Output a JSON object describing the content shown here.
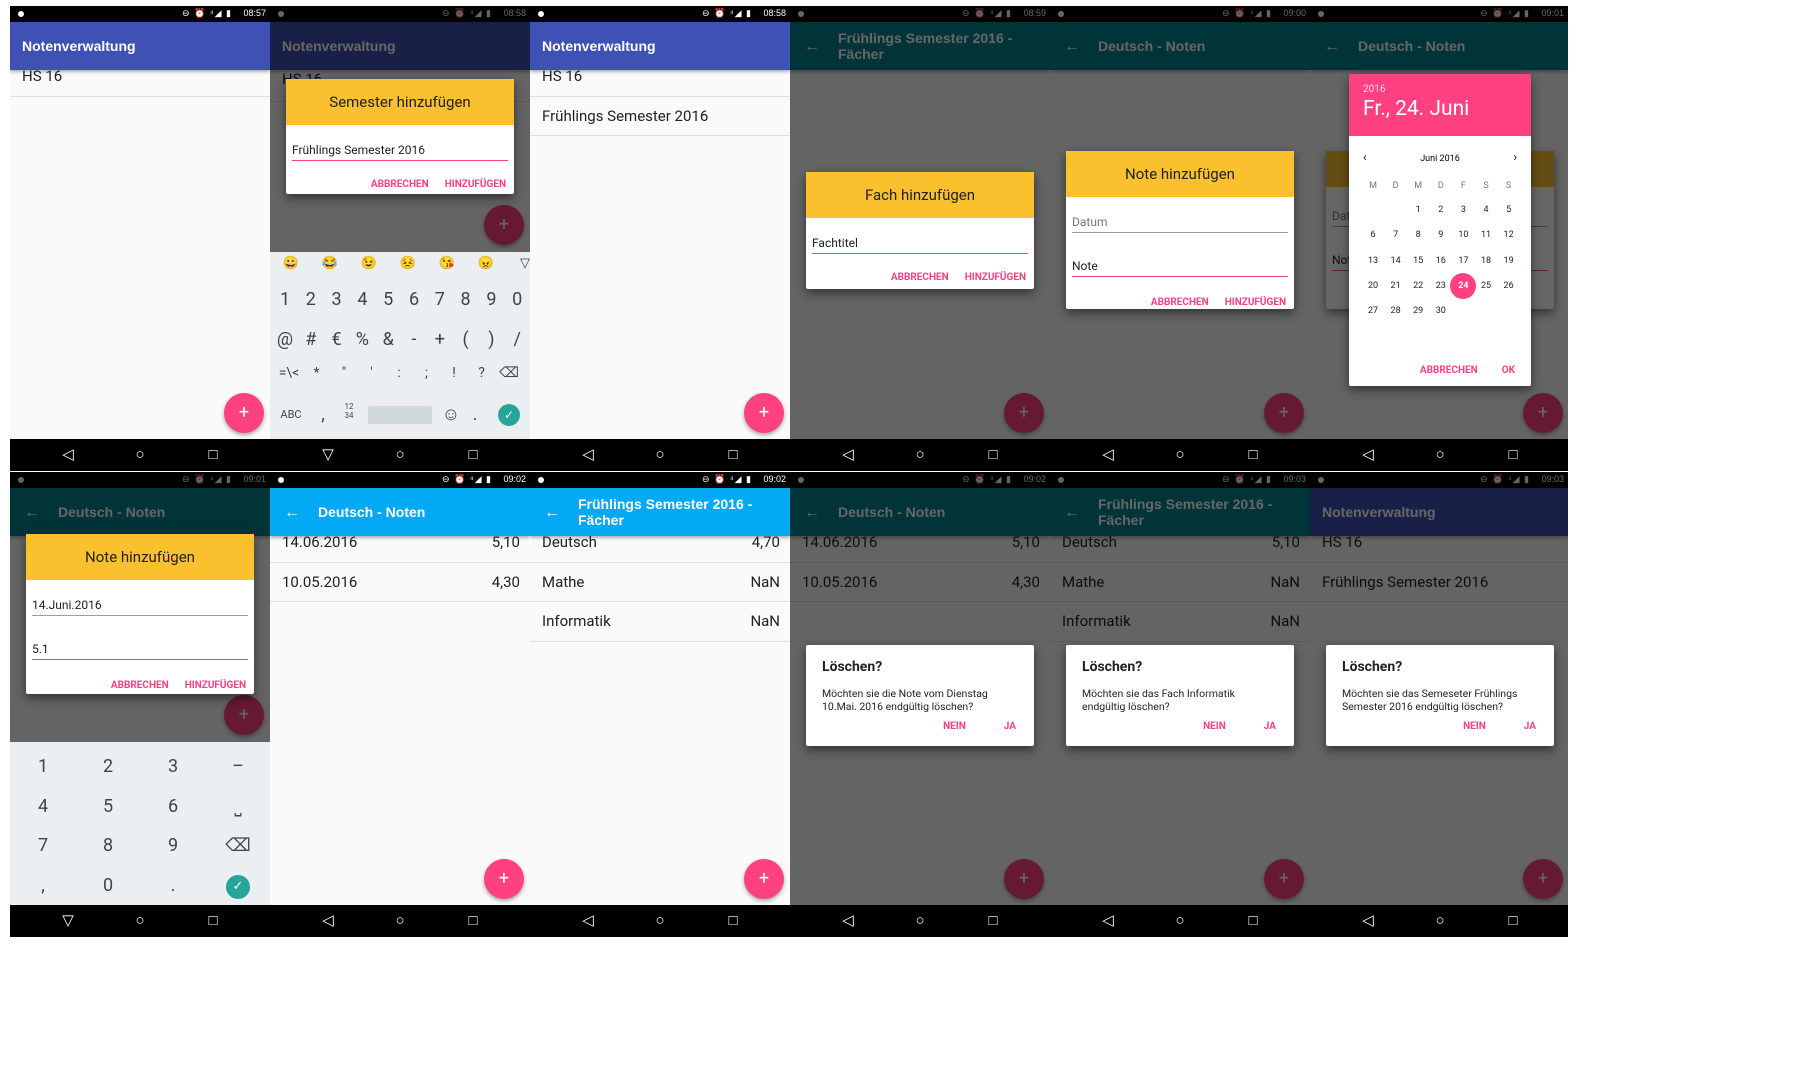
{
  "colors": {
    "indigo": "#3f51b5",
    "teal": "#00838f",
    "blue": "#03a9f4",
    "accent": "#ff4081",
    "amber": "#fbc02d"
  },
  "icons": {
    "back": "arrow-left-icon",
    "add": "plus-icon",
    "nav_back": "triangle-back-icon",
    "nav_home": "circle-home-icon",
    "nav_recent": "square-recent-icon"
  },
  "s1": {
    "time": "08:57",
    "title": "Notenverwaltung",
    "items": [
      "HS 16"
    ]
  },
  "s2": {
    "time": "08:58",
    "title": "Notenverwaltung",
    "bg_item": "HS 16",
    "dialog_title": "Semester hinzufügen",
    "field": "Frühlings Semester 2016",
    "cancel": "ABBRECHEN",
    "add": "HINZUFÜGEN",
    "emoji": [
      "😀",
      "😂",
      "😉",
      "😣",
      "😘",
      "😠",
      "▽"
    ],
    "row1": [
      "1",
      "2",
      "3",
      "4",
      "5",
      "6",
      "7",
      "8",
      "9",
      "0"
    ],
    "row2": [
      "@",
      "#",
      "€",
      "%",
      "&",
      "-",
      "+",
      "(",
      ")",
      "/"
    ],
    "row3": [
      "=\\<",
      "*",
      "\"",
      "'",
      ":",
      ";",
      "!",
      "?",
      "⌫"
    ],
    "abc": "ABC",
    "comma": ",",
    "num": "12\n34",
    "dot": "."
  },
  "s3": {
    "time": "08:58",
    "title": "Notenverwaltung",
    "items": [
      "HS 16",
      "Frühlings Semester 2016"
    ]
  },
  "s4": {
    "time": "08:59",
    "title": "Frühlings Semester 2016 - Fächer",
    "dialog_title": "Fach hinzufügen",
    "field": "Fachtitel",
    "cancel": "ABBRECHEN",
    "add": "HINZUFÜGEN"
  },
  "s5": {
    "time": "09:00",
    "title": "Deutsch - Noten",
    "dialog_title": "Note hinzufügen",
    "field1": "Datum",
    "field2": "Note",
    "cancel": "ABBRECHEN",
    "add": "HINZUFÜGEN"
  },
  "s6": {
    "time": "09:01",
    "title": "Deutsch - Noten",
    "year": "2016",
    "date": "Fr., 24. Juni",
    "month": "Juni 2016",
    "dow": [
      "M",
      "D",
      "M",
      "D",
      "F",
      "S",
      "S"
    ],
    "weeks": [
      [
        "",
        "",
        "1",
        "2",
        "3",
        "4",
        "5"
      ],
      [
        "6",
        "7",
        "8",
        "9",
        "10",
        "11",
        "12"
      ],
      [
        "13",
        "14",
        "15",
        "16",
        "17",
        "18",
        "19"
      ],
      [
        "20",
        "21",
        "22",
        "23",
        "24",
        "25",
        "26"
      ],
      [
        "27",
        "28",
        "29",
        "30",
        "",
        "",
        ""
      ]
    ],
    "cancel": "ABBRECHEN",
    "ok": "OK",
    "bg1": "Dat",
    "bg2": "Not"
  },
  "s7": {
    "time": "09:01",
    "title": "Deutsch - Noten",
    "dialog_title": "Note hinzufügen",
    "field1": "14.Juni.2016",
    "field2": "5.1",
    "cancel": "ABBRECHEN",
    "add": "HINZUFÜGEN",
    "keys": [
      [
        "1",
        "2",
        "3",
        "–"
      ],
      [
        "4",
        "5",
        "6",
        "⎵"
      ],
      [
        "7",
        "8",
        "9",
        "⌫"
      ],
      [
        ",",
        "0",
        ".",
        "✓"
      ]
    ]
  },
  "s8": {
    "time": "09:02",
    "title": "Deutsch - Noten",
    "rows": [
      {
        "l": "14.06.2016",
        "r": "5,10"
      },
      {
        "l": "10.05.2016",
        "r": "4,30"
      }
    ]
  },
  "s9": {
    "time": "09:02",
    "title": "Frühlings Semester 2016 - Fächer",
    "rows": [
      {
        "l": "Deutsch",
        "r": "4,70"
      },
      {
        "l": "Mathe",
        "r": "NaN"
      },
      {
        "l": "Informatik",
        "r": "NaN"
      }
    ]
  },
  "s10": {
    "time": "09:02",
    "title": "Deutsch - Noten",
    "rows": [
      {
        "l": "14.06.2016",
        "r": "5,10"
      },
      {
        "l": "10.05.2016",
        "r": "4,30"
      }
    ],
    "dh": "Löschen?",
    "dm": "Möchten sie die Note vom Dienstag 10.Mai. 2016 endgültig löschen?",
    "no": "NEIN",
    "yes": "JA"
  },
  "s11": {
    "time": "09:03",
    "title": "Frühlings Semester 2016 - Fächer",
    "rows": [
      {
        "l": "Deutsch",
        "r": "5,10"
      },
      {
        "l": "Mathe",
        "r": "NaN"
      },
      {
        "l": "Informatik",
        "r": "NaN"
      }
    ],
    "dh": "Löschen?",
    "dm": "Möchten sie das Fach Informatik endgültig löschen?",
    "no": "NEIN",
    "yes": "JA"
  },
  "s12": {
    "time": "09:03",
    "title": "Notenverwaltung",
    "rows": [
      {
        "l": "HS 16",
        "r": ""
      },
      {
        "l": "Frühlings Semester 2016",
        "r": ""
      }
    ],
    "dh": "Löschen?",
    "dm": "Möchten sie das Semeseter Frühlings Semester 2016 endgültig löschen?",
    "no": "NEIN",
    "yes": "JA"
  },
  "fab_plus": "+",
  "back_arrow": "←",
  "nav": {
    "back": "◁",
    "home": "○",
    "recent": "□",
    "kbback": "▽"
  },
  "status_icons": "⊖ ⏰ ⁴◢ ▮"
}
